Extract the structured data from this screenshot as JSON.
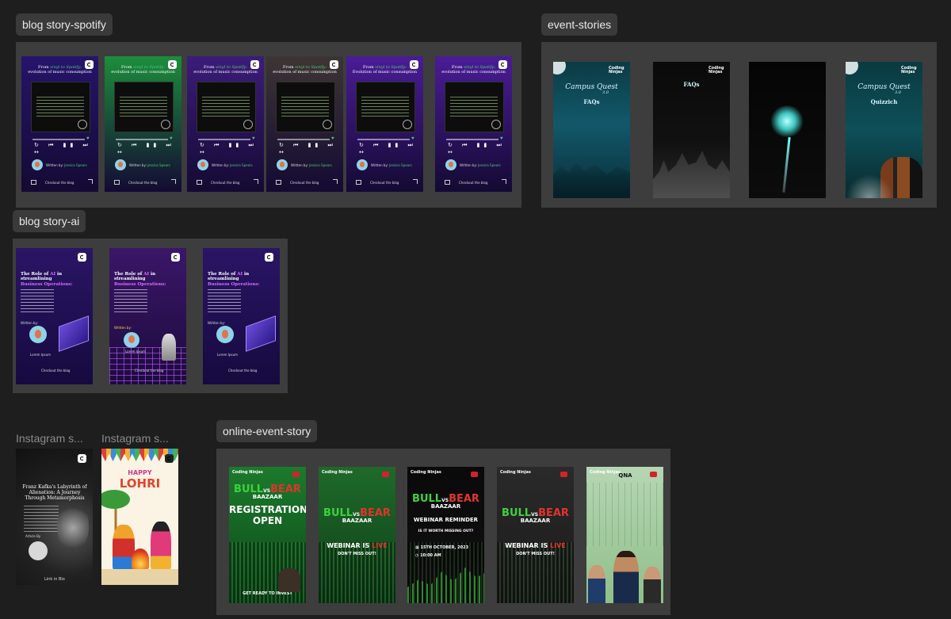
{
  "canvas": {
    "background": "#1e1e1e",
    "section_color": "#3d3d3d"
  },
  "sections": {
    "spotify": {
      "label": "blog story-spotify",
      "frames": [
        {
          "bg": "#26146b",
          "title_pre": "From",
          "title_highlight": "vinyl to Spotify:",
          "title_post": "evolution of music consumption",
          "writer": "Written by:",
          "name": "Jessica Spears",
          "cta": "Checkout the blog"
        },
        {
          "bg": "#1c8d3c",
          "title_pre": "From",
          "title_highlight": "vinyl to Spotify:",
          "title_post": "evolution of music consumption",
          "writer": "Written by:",
          "name": "Jessica Spears",
          "cta": "Checkout the blog"
        },
        {
          "bg": "#3c1c7a",
          "title_pre": "From",
          "title_highlight": "vinyl to Spotify:",
          "title_post": "evolution of music consumption",
          "writer": "Written by:",
          "name": "Jessica Spears",
          "cta": "Checkout the blog"
        },
        {
          "bg": "#3d3534",
          "title_pre": "From",
          "title_highlight": "vinyl to Spotify:",
          "title_post": "evolution of music consumption",
          "writer": "Written by:",
          "name": "Jessica Spears",
          "cta": "Checkout the blog"
        },
        {
          "bg": "#4a1c96",
          "title_pre": "From",
          "title_highlight": "vinyl to Spotify:",
          "title_post": "Evolution of music consumption",
          "writer": "Written by:",
          "name": "Jessica Spears",
          "cta": "Checkout the blog"
        },
        {
          "bg": "#4a1c96",
          "title_pre": "From",
          "title_highlight": "vinyl to Spotify:",
          "title_post": "evolution of music consumption",
          "writer": "Written by:",
          "name": "Jessica Spears",
          "cta": "Checkout the blog"
        }
      ]
    },
    "event": {
      "label": "event-stories",
      "frames": [
        {
          "title": "Campus Quest",
          "num": "3.0",
          "sub": "FAQs",
          "brand": "Coding Ninjas"
        },
        {
          "title": "",
          "num": "",
          "sub": "FAQs",
          "brand": "Coding Ninjas"
        },
        {
          "title": "",
          "num": "",
          "sub": "",
          "brand": ""
        },
        {
          "title": "Campus Quest",
          "num": "3.0",
          "sub": "Quizzich",
          "brand": "Coding Ninjas"
        }
      ]
    },
    "ai": {
      "label": "blog story-ai",
      "frames": [
        {
          "t1": "The Role of",
          "hl1": "AI",
          "t2": "in streamlining",
          "hl2": "Business Operations:",
          "writer": "Written by:",
          "name": "Lorem Ipsum",
          "cta": "Checkout the blog"
        },
        {
          "t1": "The Role of",
          "hl1": "AI",
          "t2": "in streamlining",
          "hl2": "Business Operations:",
          "writer": "Written by:",
          "name": "Lorem Ipsum",
          "cta": "Checkout the blog"
        },
        {
          "t1": "The Role of",
          "hl1": "AI",
          "t2": "in streamlining",
          "hl2": "Business Operations:",
          "writer": "Written by:",
          "name": "Lorem Ipsum",
          "cta": "Checkout the blog"
        }
      ]
    },
    "instagram": {
      "label1": "Instagram s...",
      "label2": "Instagram s...",
      "kafka_title": "Franz Kafka's Labyrinth of Alienation: A Journey Through Metamorphosis",
      "kafka_writer": "Article By",
      "kafka_cta": "Link in Bio",
      "lohri_happy": "HAPPY",
      "lohri_title": "LOHRI"
    },
    "online": {
      "label": "online-event-story",
      "frames": [
        {
          "bull": "BULL",
          "vs": "VS",
          "bear": "BEAR",
          "baazaar": "BAAZAAR",
          "line1": "REGISTRATIONS",
          "line2": "OPEN",
          "foot": "GET READY TO INVEST"
        },
        {
          "bull": "BULL",
          "vs": "VS",
          "bear": "BEAR",
          "baazaar": "BAAZAAR",
          "line1": "WEBINAR IS",
          "line1b": "LIVE",
          "line2": "DON'T MISS OUT!",
          "foot": ""
        },
        {
          "bull": "BULL",
          "vs": "VS",
          "bear": "BEAR",
          "baazaar": "BAAZAAR",
          "line1": "WEBINAR REMINDER",
          "line2": "IS IT WORTH MISSING OUT?",
          "date": "15TH OCTOBER, 2023",
          "time": "10:00 AM"
        },
        {
          "bull": "BULL",
          "vs": "VS",
          "bear": "BEAR",
          "baazaar": "BAAZAAR",
          "line1": "WEBINAR IS",
          "line1b": "LIVE",
          "line2": "DON'T MISS OUT!",
          "foot": ""
        },
        {
          "qna": "QNA"
        }
      ],
      "brand": "Coding Ninjas"
    }
  }
}
